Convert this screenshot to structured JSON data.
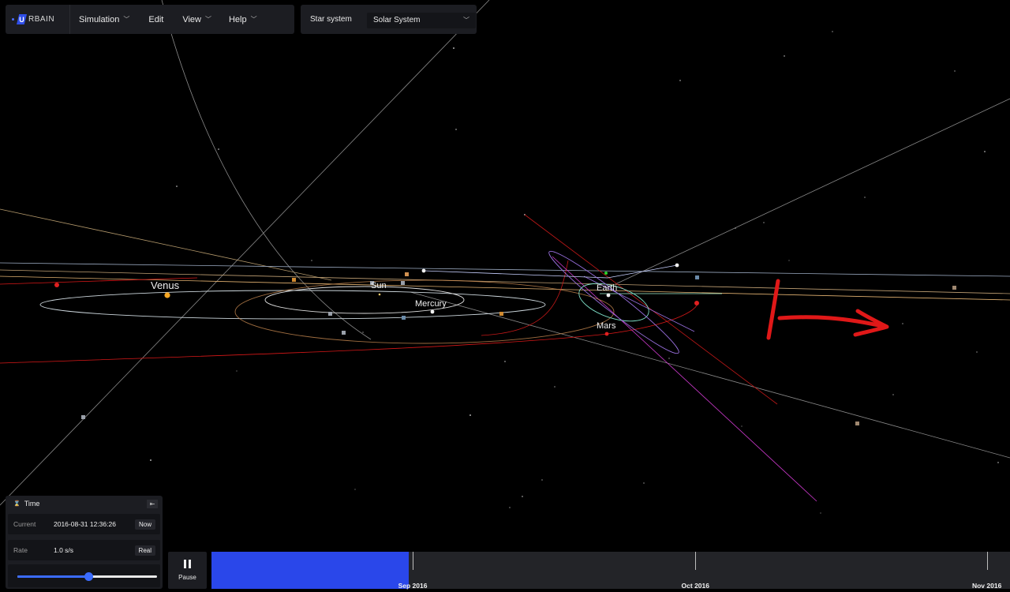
{
  "menubar": {
    "logo_text": "RBAIN",
    "logo_letter": "U",
    "items": [
      {
        "label": "Simulation",
        "has_dropdown": true
      },
      {
        "label": "Edit",
        "has_dropdown": false
      },
      {
        "label": "View",
        "has_dropdown": true
      },
      {
        "label": "Help",
        "has_dropdown": true
      }
    ]
  },
  "star_system": {
    "label": "Star system",
    "selected": "Solar System"
  },
  "scene": {
    "labels": {
      "venus": "Venus",
      "sun": "Sun",
      "mercury": "Mercury",
      "earth": "Earth",
      "mars": "Mars"
    }
  },
  "time_panel": {
    "title": "Time",
    "current_label": "Current",
    "current_value": "2016-08-31 12:36:26",
    "now_button": "Now",
    "rate_label": "Rate",
    "rate_value": "1.0 s/s",
    "real_button": "Real",
    "rate_slider_fraction": 0.51
  },
  "pause": {
    "label": "Pause"
  },
  "timeline": {
    "progress_fraction": 0.247,
    "ticks": [
      {
        "label": "Sep 2016",
        "fraction": 0.252
      },
      {
        "label": "Oct 2016",
        "fraction": 0.606
      },
      {
        "label": "Nov 2016",
        "fraction": 0.971
      }
    ]
  },
  "colors": {
    "accent": "#2a47ea",
    "annotation": "#e01818"
  }
}
